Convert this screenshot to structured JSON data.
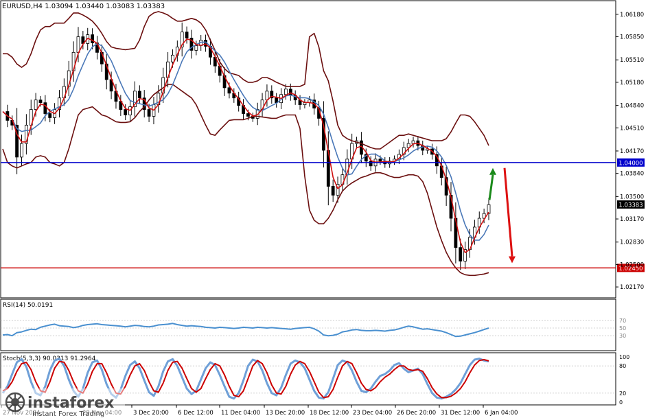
{
  "window": {
    "symbol_info": "EURUSD,H4  1.03094 1.03440 1.03083 1.03383"
  },
  "colors": {
    "background": "#ffffff",
    "candle": "#000000",
    "bollinger": "#6b0f0f",
    "ma_fast": "#d01010",
    "ma_slow": "#4a78b8",
    "support_line": "#cc0000",
    "resistance_line": "#0000cc",
    "arrow_up": "#1a8a1a",
    "arrow_down": "#dd1111",
    "rsi_line": "#4a90d0",
    "stoch_main": "#6fa0d8",
    "stoch_signal": "#cc0000",
    "price_badge": "#000000"
  },
  "chart_data": [
    {
      "type": "line",
      "title": "EURUSD,H4  1.03094 1.03440 1.03083 1.03383",
      "price_axis_labels": [
        "1.06180",
        "1.05850",
        "1.05510",
        "1.05180",
        "1.04840",
        "1.04510",
        "1.04170",
        "1.03840",
        "1.03500",
        "1.03170",
        "1.02830",
        "1.02500",
        "1.02170"
      ],
      "ylim": [
        1.0205,
        1.0633
      ],
      "x_tick_labels": [
        "27 Nov 2024",
        "29 Nov 04:00",
        "3 Dec 20:00",
        "6 Dec 12:00",
        "11 Dec 04:00",
        "13 Dec 20:00",
        "18 Dec 12:00",
        "23 Dec 04:00",
        "26 Dec 20:00",
        "31 Dec 12:00",
        "6 Jan 04:00"
      ],
      "current_price": "1.03383",
      "horizontal_levels": [
        {
          "value": 1.04,
          "label": "1.04000",
          "color": "#0000cc"
        },
        {
          "value": 1.0245,
          "label": "1.02450",
          "color": "#cc0000"
        }
      ],
      "forecast_arrows": [
        {
          "direction": "up",
          "from": 1.0345,
          "to": 1.0392,
          "color": "#1a8a1a"
        },
        {
          "direction": "down",
          "from": 1.0392,
          "to": 1.0252,
          "color": "#dd1111"
        }
      ],
      "series": [
        {
          "kind": "close",
          "values": [
            1.0475,
            1.0462,
            1.0455,
            1.0408,
            1.0428,
            1.0455,
            1.0478,
            1.0492,
            1.0488,
            1.0472,
            1.0466,
            1.0478,
            1.0495,
            1.0512,
            1.0535,
            1.0562,
            1.0585,
            1.0575,
            1.0588,
            1.0576,
            1.0562,
            1.0545,
            1.0522,
            1.0505,
            1.049,
            1.0478,
            1.047,
            1.0482,
            1.0505,
            1.0495,
            1.0478,
            1.0468,
            1.0485,
            1.0502,
            1.0525,
            1.0548,
            1.0558,
            1.057,
            1.0592,
            1.0583,
            1.0565,
            1.0572,
            1.058,
            1.0571,
            1.0555,
            1.0542,
            1.0528,
            1.051,
            1.0502,
            1.0495,
            1.0484,
            1.0472,
            1.0468,
            1.0465,
            1.0478,
            1.0492,
            1.0505,
            1.0495,
            1.0488,
            1.05,
            1.0508,
            1.0499,
            1.0492,
            1.0485,
            1.0488,
            1.0492,
            1.048,
            1.0465,
            1.0418,
            1.0365,
            1.0352,
            1.0368,
            1.0382,
            1.0405,
            1.0428,
            1.0432,
            1.0412,
            1.0402,
            1.0395,
            1.0405,
            1.0402,
            1.0398,
            1.0402,
            1.0405,
            1.0412,
            1.0422,
            1.0428,
            1.0432,
            1.0425,
            1.0418,
            1.042,
            1.0412,
            1.0395,
            1.0378,
            1.0352,
            1.0318,
            1.0275,
            1.0255,
            1.0272,
            1.029,
            1.0305,
            1.0318,
            1.0325,
            1.0338
          ]
        },
        {
          "kind": "bollinger_upper",
          "values": [
            1.056,
            1.056,
            1.0555,
            1.0545,
            1.054,
            1.0545,
            1.056,
            1.058,
            1.0595,
            1.06,
            1.06,
            1.0605,
            1.0605,
            1.0605,
            1.0612,
            1.062,
            1.062,
            1.0617,
            1.0613,
            1.0608,
            1.06,
            1.059,
            1.0578,
            1.057,
            1.0568,
            1.0567,
            1.0566,
            1.0567,
            1.0568,
            1.058,
            1.06,
            1.0615,
            1.062,
            1.0622,
            1.062,
            1.0617,
            1.0612,
            1.0608,
            1.0608,
            1.061,
            1.0612,
            1.061,
            1.0605,
            1.0595,
            1.058,
            1.0565,
            1.0548,
            1.0538,
            1.0532,
            1.053,
            1.0528,
            1.0522,
            1.0518,
            1.0518,
            1.052,
            1.0525,
            1.0525,
            1.0522,
            1.0518,
            1.0515,
            1.0512,
            1.0512,
            1.0512,
            1.0512,
            1.0515,
            1.0585,
            1.059,
            1.057,
            1.0535,
            1.052,
            1.049,
            1.0455,
            1.044,
            1.0435,
            1.0432,
            1.043,
            1.0428,
            1.0425,
            1.0422,
            1.042,
            1.042,
            1.0425,
            1.043,
            1.0435,
            1.044,
            1.044,
            1.0442,
            1.044,
            1.0438,
            1.0436,
            1.0434,
            1.0432,
            1.0432,
            1.0432,
            1.0435,
            1.0445,
            1.0458,
            1.047,
            1.047,
            1.0468,
            1.046,
            1.045,
            1.044,
            1.0425
          ]
        },
        {
          "kind": "bollinger_lower",
          "values": [
            1.042,
            1.04,
            1.0395,
            1.0392,
            1.0395,
            1.0398,
            1.04,
            1.0408,
            1.041,
            1.0408,
            1.04,
            1.0398,
            1.0395,
            1.04,
            1.042,
            1.0445,
            1.047,
            1.0478,
            1.048,
            1.0482,
            1.0476,
            1.047,
            1.0468,
            1.0464,
            1.046,
            1.0459,
            1.0459,
            1.046,
            1.0466,
            1.0475,
            1.0482,
            1.0492,
            1.05,
            1.0505,
            1.051,
            1.0515,
            1.0515,
            1.051,
            1.0505,
            1.05,
            1.0495,
            1.0485,
            1.047,
            1.0455,
            1.0442,
            1.044,
            1.0448,
            1.0455,
            1.0462,
            1.0463,
            1.0463,
            1.0463,
            1.0465,
            1.0468,
            1.0468,
            1.0467,
            1.0466,
            1.0465,
            1.0465,
            1.0468,
            1.047,
            1.047,
            1.047,
            1.045,
            1.038,
            1.033,
            1.0315,
            1.031,
            1.031,
            1.0318,
            1.033,
            1.0345,
            1.0358,
            1.0365,
            1.037,
            1.0374,
            1.0378,
            1.038,
            1.0383,
            1.0385,
            1.0385,
            1.0383,
            1.038,
            1.0378,
            1.0378,
            1.038,
            1.0382,
            1.0382,
            1.038,
            1.0372,
            1.0355,
            1.033,
            1.0305,
            1.0285,
            1.0268,
            1.0255,
            1.0245,
            1.0238,
            1.0235,
            1.0234,
            1.0234,
            1.0235,
            1.0236,
            1.0238
          ]
        }
      ]
    },
    {
      "type": "line",
      "title": "RSI(14) 50.0191",
      "levels_printed": [
        "70",
        "50",
        "30"
      ],
      "ylim": [
        0,
        100
      ],
      "current_value": 50.0191,
      "values": [
        32,
        33,
        30,
        38,
        40,
        44,
        47,
        46,
        52,
        55,
        58,
        60,
        56,
        55,
        54,
        51,
        53,
        57,
        59,
        60,
        61,
        59,
        58,
        57,
        56,
        55,
        53,
        55,
        57,
        56,
        54,
        53,
        55,
        58,
        59,
        60,
        62,
        59,
        57,
        55,
        56,
        55,
        54,
        52,
        51,
        50,
        52,
        51,
        50,
        49,
        50,
        52,
        51,
        50,
        52,
        51,
        50,
        51,
        50,
        49,
        48,
        47,
        49,
        50,
        51,
        52,
        48,
        42,
        32,
        30,
        31,
        34,
        40,
        42,
        45,
        46,
        44,
        43,
        43,
        44,
        43,
        42,
        44,
        45,
        48,
        52,
        55,
        53,
        50,
        47,
        48,
        46,
        44,
        42,
        38,
        33,
        28,
        29,
        32,
        35,
        38,
        42,
        46,
        50
      ]
    },
    {
      "type": "line",
      "title": "Stoch(5,3,3) 90.0313 91.2964",
      "levels_printed": [
        "100",
        "80",
        "20",
        "0"
      ],
      "ylim": [
        0,
        100
      ],
      "main_value": 90.0313,
      "signal_value": 91.2964,
      "main": [
        20,
        35,
        62,
        88,
        95,
        78,
        45,
        20,
        15,
        35,
        70,
        92,
        96,
        80,
        50,
        25,
        12,
        30,
        65,
        88,
        92,
        72,
        40,
        18,
        10,
        28,
        58,
        82,
        90,
        75,
        48,
        22,
        14,
        35,
        68,
        90,
        95,
        80,
        55,
        30,
        18,
        25,
        50,
        75,
        88,
        82,
        60,
        35,
        12,
        8,
        20,
        48,
        80,
        94,
        90,
        70,
        42,
        20,
        15,
        32,
        60,
        85,
        92,
        88,
        75,
        50,
        25,
        10,
        8,
        22,
        52,
        82,
        92,
        88,
        70,
        45,
        25,
        22,
        30,
        45,
        58,
        62,
        70,
        82,
        86,
        74,
        66,
        70,
        74,
        62,
        40,
        20,
        10,
        8,
        12,
        18,
        28,
        42,
        62,
        82,
        94,
        96,
        92,
        90
      ],
      "signal": [
        25,
        30,
        45,
        68,
        85,
        88,
        72,
        45,
        25,
        22,
        45,
        75,
        90,
        88,
        70,
        45,
        25,
        20,
        40,
        68,
        85,
        85,
        65,
        40,
        20,
        18,
        35,
        60,
        80,
        85,
        70,
        45,
        25,
        22,
        42,
        70,
        88,
        90,
        75,
        52,
        30,
        22,
        30,
        52,
        72,
        85,
        80,
        60,
        35,
        15,
        12,
        25,
        52,
        80,
        92,
        85,
        65,
        38,
        20,
        18,
        35,
        62,
        82,
        90,
        85,
        68,
        45,
        22,
        10,
        12,
        28,
        55,
        80,
        90,
        85,
        65,
        42,
        28,
        25,
        32,
        45,
        55,
        62,
        72,
        80,
        80,
        72,
        70,
        72,
        68,
        52,
        32,
        18,
        10,
        10,
        13,
        20,
        30,
        45,
        65,
        82,
        92,
        94,
        91
      ]
    }
  ],
  "watermark": {
    "brand": "instaforex",
    "tagline": "Instant Forex Trading"
  }
}
